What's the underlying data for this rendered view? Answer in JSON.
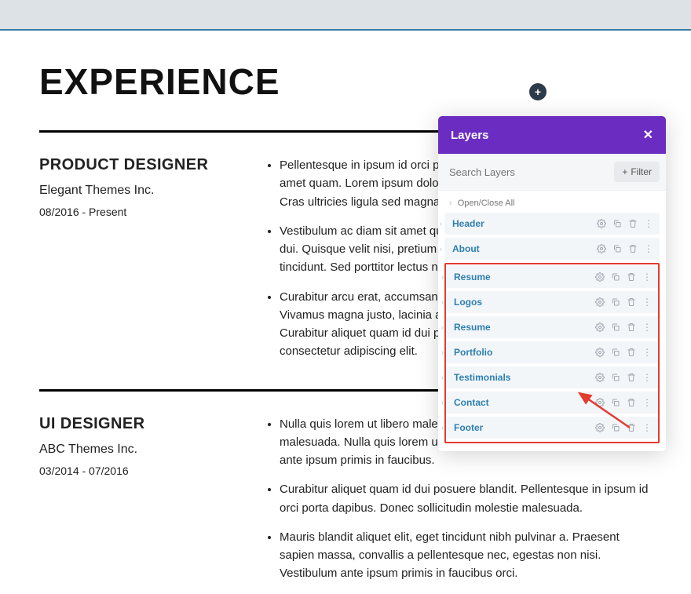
{
  "section_heading": "EXPERIENCE",
  "jobs": [
    {
      "title": "PRODUCT DESIGNER",
      "company": "Elegant Themes Inc.",
      "dates": "08/2016 - Present",
      "bullets": [
        "Pellentesque in ipsum id orci porta dapibus. Vestibulum ac diam sit amet quam. Lorem ipsum dolor sit amet, consectetur adipiscing elit. Cras ultricies ligula sed magna dictum porta.",
        "Vestibulum ac diam sit amet quam vehicula elementum sed sit amet dui. Quisque velit nisi, pretium ut lacinia in, elementum id accumsan tincidunt. Sed porttitor lectus nibh.",
        "Curabitur arcu erat, accumsan id imperdiet et, porttitor at sem. Vivamus magna justo, lacinia amet nisl tempus convallis quis ac lectus. Curabitur aliquet quam id dui posuere. Lorem ipsum dolor sit amet, consectetur adipiscing elit."
      ]
    },
    {
      "title": "UI DESIGNER",
      "company": "ABC Themes Inc.",
      "dates": "03/2014 - 07/2016",
      "bullets": [
        "Nulla quis lorem ut libero malesuada feugiat. Nulla quis lorem ut libero malesuada. Nulla quis lorem ut libero malesuada feugiat. Vestibulum ante ipsum primis in faucibus.",
        "Curabitur aliquet quam id dui posuere blandit. Pellentesque in ipsum id orci porta dapibus. Donec sollicitudin molestie malesuada.",
        "Mauris blandit aliquet elit, eget tincidunt nibh pulvinar a. Praesent sapien massa, convallis a pellentesque nec, egestas non nisi. Vestibulum ante ipsum primis in faucibus orci."
      ]
    }
  ],
  "panel": {
    "title": "Layers",
    "search_placeholder": "Search Layers",
    "filter_label": "Filter",
    "toggle_label": "Open/Close All",
    "groups": {
      "ungrouped": [
        {
          "name": "Header"
        },
        {
          "name": "About"
        }
      ],
      "highlighted": [
        {
          "name": "Resume"
        },
        {
          "name": "Logos"
        },
        {
          "name": "Resume"
        },
        {
          "name": "Portfolio"
        },
        {
          "name": "Testimonials"
        },
        {
          "name": "Contact"
        },
        {
          "name": "Footer"
        }
      ]
    }
  },
  "icons": {
    "plus": "+",
    "close": "✕",
    "chevron": "›",
    "dots": "⋮"
  }
}
